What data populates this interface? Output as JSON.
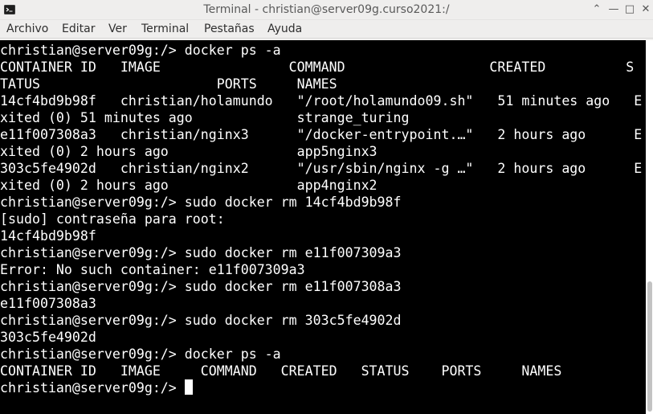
{
  "window": {
    "title": "Terminal - christian@server09g.curso2021:/",
    "buttons": {
      "sticky": "⌃",
      "minimize": "—",
      "maximize": "□",
      "close": "✕"
    }
  },
  "menu": {
    "items": [
      "Archivo",
      "Editar",
      "Ver",
      "Terminal",
      "Pestañas",
      "Ayuda"
    ]
  },
  "terminal": {
    "lines": [
      "christian@server09g:/> docker ps -a",
      "CONTAINER ID   IMAGE                COMMAND                  CREATED          S",
      "TATUS                      PORTS     NAMES",
      "14cf4bd9b98f   christian/holamundo   \"/root/holamundo09.sh\"   51 minutes ago   E",
      "xited (0) 51 minutes ago             strange_turing",
      "e11f007308a3   christian/nginx3      \"/docker-entrypoint.…\"   2 hours ago      E",
      "xited (0) 2 hours ago                app5nginx3",
      "303c5fe4902d   christian/nginx2      \"/usr/sbin/nginx -g …\"   2 hours ago      E",
      "xited (0) 2 hours ago                app4nginx2",
      "christian@server09g:/> sudo docker rm 14cf4bd9b98f",
      "[sudo] contraseña para root:",
      "14cf4bd9b98f",
      "christian@server09g:/> sudo docker rm e11f007309a3",
      "Error: No such container: e11f007309a3",
      "christian@server09g:/> sudo docker rm e11f007308a3",
      "e11f007308a3",
      "christian@server09g:/> sudo docker rm 303c5fe4902d",
      "303c5fe4902d",
      "christian@server09g:/> docker ps -a",
      "CONTAINER ID   IMAGE     COMMAND   CREATED   STATUS    PORTS     NAMES",
      "christian@server09g:/> "
    ]
  },
  "colors": {
    "terminal_bg": "#000000",
    "terminal_fg": "#ffffff",
    "chrome_bg": "#efeeed"
  }
}
